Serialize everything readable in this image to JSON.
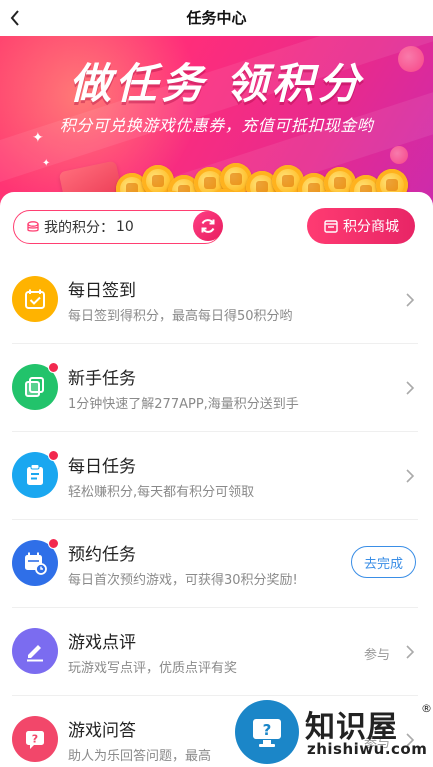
{
  "navbar": {
    "title": "任务中心"
  },
  "banner": {
    "title": "做任务 领积分",
    "subtitle": "积分可兑换游戏优惠券，充值可抵扣现金哟"
  },
  "points": {
    "label": "我的积分：",
    "value": "10",
    "mall_label": "积分商城"
  },
  "tasks": [
    {
      "title": "每日签到",
      "desc": "每日签到得积分，最高每日得50积分哟",
      "icon": "calendar-check-icon",
      "color": "#ffb300",
      "dot": false,
      "action": "chevron"
    },
    {
      "title": "新手任务",
      "desc": "1分钟快速了解277APP,海量积分送到手",
      "icon": "copy-icon",
      "color": "#22c36b",
      "dot": true,
      "action": "chevron"
    },
    {
      "title": "每日任务",
      "desc": "轻松赚积分,每天都有积分可领取",
      "icon": "clipboard-icon",
      "color": "#1aa7f0",
      "dot": true,
      "action": "chevron"
    },
    {
      "title": "预约任务",
      "desc": "每日首次预约游戏，可获得30积分奖励!",
      "icon": "calendar-clock-icon",
      "color": "#2f6fe8",
      "dot": true,
      "action": "button",
      "action_label": "去完成"
    },
    {
      "title": "游戏点评",
      "desc": "玩游戏写点评，优质点评有奖",
      "icon": "pencil-icon",
      "color": "#7b6cf0",
      "dot": false,
      "action": "chevron",
      "side_text": "参与"
    },
    {
      "title": "游戏问答",
      "desc": "助人为乐回答问题，最高",
      "icon": "question-chat-icon",
      "color": "#f2476a",
      "dot": false,
      "action": "chevron",
      "side_text": "参与"
    }
  ],
  "watermark": {
    "cn": "知识屋",
    "reg": "®",
    "en": "zhishiwu.com"
  }
}
